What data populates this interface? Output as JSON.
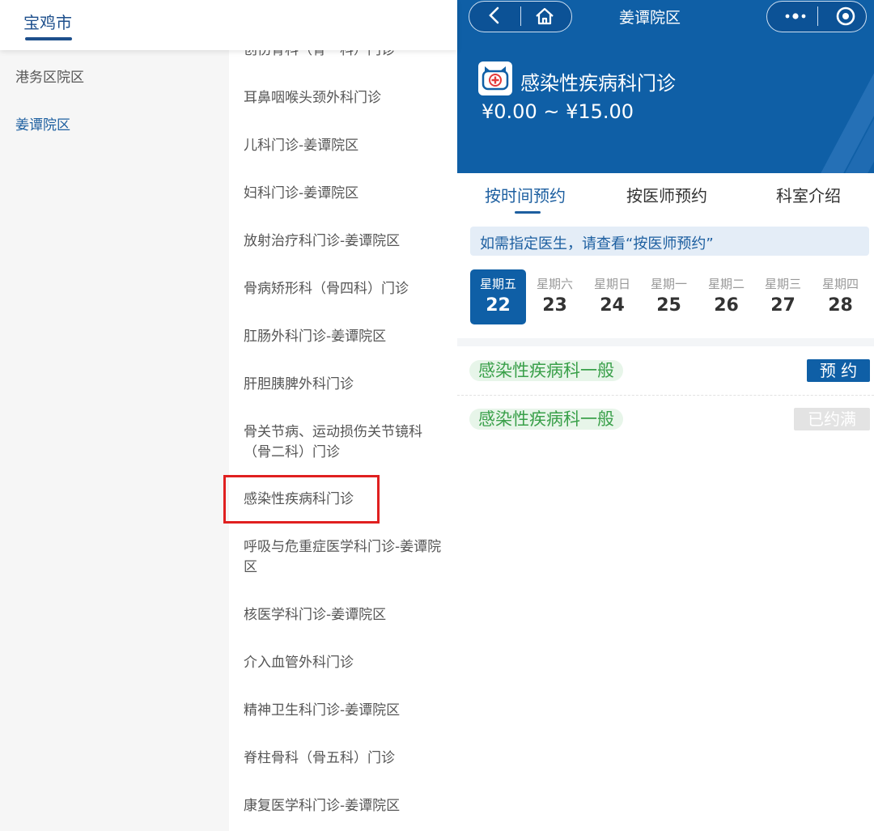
{
  "left": {
    "city": "宝鸡市",
    "campuses": [
      "港务区院区",
      "姜谭院区"
    ],
    "departments": [
      "创伤骨科（骨一科）门诊",
      "耳鼻咽喉头颈外科门诊",
      "儿科门诊-姜谭院区",
      "妇科门诊-姜谭院区",
      "放射治疗科门诊-姜谭院区",
      "骨病矫形科（骨四科）门诊",
      "肛肠外科门诊-姜谭院区",
      "肝胆胰脾外科门诊",
      "骨关节病、运动损伤关节镜科（骨二科）门诊",
      "感染性疾病科门诊",
      "呼吸与危重症医学科门诊-姜谭院区",
      "核医学科门诊-姜谭院区",
      "介入血管外科门诊",
      "精神卫生科门诊-姜谭院区",
      "脊柱骨科（骨五科）门诊",
      "康复医学科门诊-姜谭院区"
    ]
  },
  "right": {
    "nav_title": "姜谭院区",
    "dept_title": "感染性疾病科门诊",
    "price": "¥0.00 ~ ¥15.00",
    "tabs": [
      "按时间预约",
      "按医师预约",
      "科室介绍"
    ],
    "tip": "如需指定医生，请查看“按医师预约”",
    "days": [
      {
        "wk": "星期五",
        "d": "22"
      },
      {
        "wk": "星期六",
        "d": "23"
      },
      {
        "wk": "星期日",
        "d": "24"
      },
      {
        "wk": "星期一",
        "d": "25"
      },
      {
        "wk": "星期二",
        "d": "26"
      },
      {
        "wk": "星期三",
        "d": "27"
      },
      {
        "wk": "星期四",
        "d": "28"
      }
    ],
    "slots": [
      {
        "name": "感染性疾病科一般",
        "btn": "预 约"
      },
      {
        "name": "感染性疾病科一般",
        "btn": "已约满"
      }
    ]
  },
  "colors": {
    "primary": "#0f5fa6",
    "highlight_box": "#e02020",
    "slot_green": "#3aa04a"
  }
}
